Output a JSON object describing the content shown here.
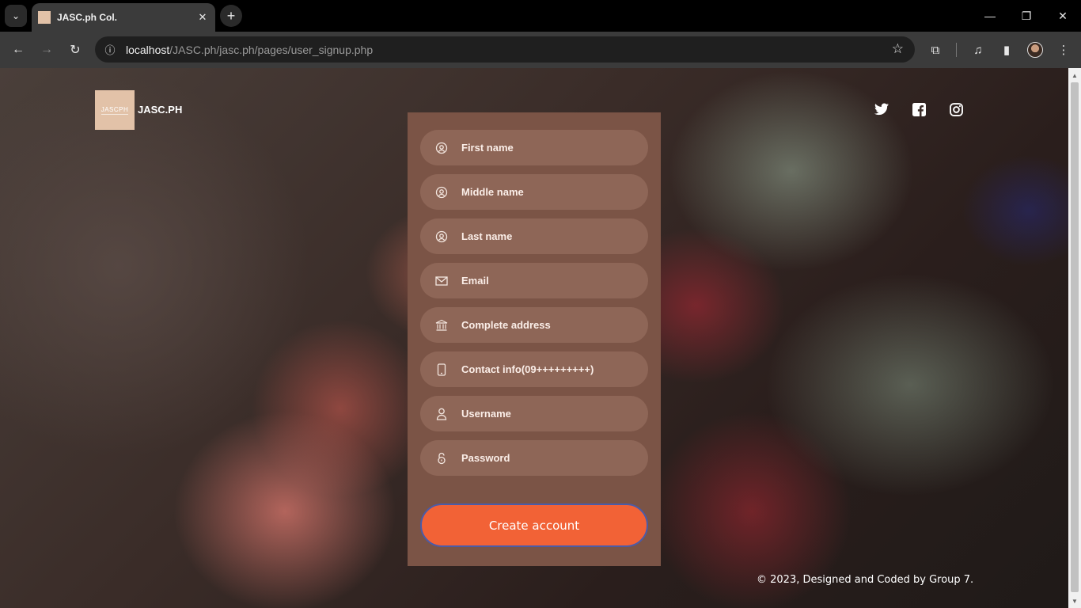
{
  "browser": {
    "tab_title": "JASC.ph Col.",
    "url_host": "localhost",
    "url_path": "/JASC.ph/jasc.ph/pages/user_signup.php"
  },
  "page": {
    "logo_text": "JASCPH",
    "brand": "JASC.PH",
    "form": {
      "first_name_placeholder": "First name",
      "middle_name_placeholder": "Middle name",
      "last_name_placeholder": "Last name",
      "email_placeholder": "Email",
      "address_placeholder": "Complete address",
      "contact_placeholder": "Contact info(09+++++++++)",
      "username_placeholder": "Username",
      "password_placeholder": "Password",
      "submit_label": "Create account"
    },
    "footer": "© 2023, Designed and Coded by Group 7."
  },
  "colors": {
    "card": "#7b5446",
    "field": "#8e6657",
    "button": "#f26236",
    "logo_bg": "#e2c2a8"
  }
}
